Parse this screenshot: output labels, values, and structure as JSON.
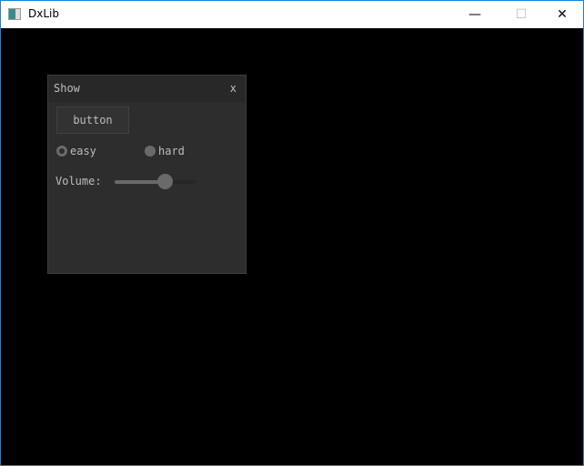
{
  "window": {
    "title": "DxLib",
    "minimize": "—",
    "maximize": "☐",
    "close": "✕"
  },
  "panel": {
    "title": "Show",
    "close": "x",
    "button_label": "button",
    "radios": [
      {
        "label": "easy",
        "selected": true
      },
      {
        "label": "hard",
        "selected": false
      }
    ],
    "volume_label": "Volume:",
    "volume_value": 0.62
  }
}
